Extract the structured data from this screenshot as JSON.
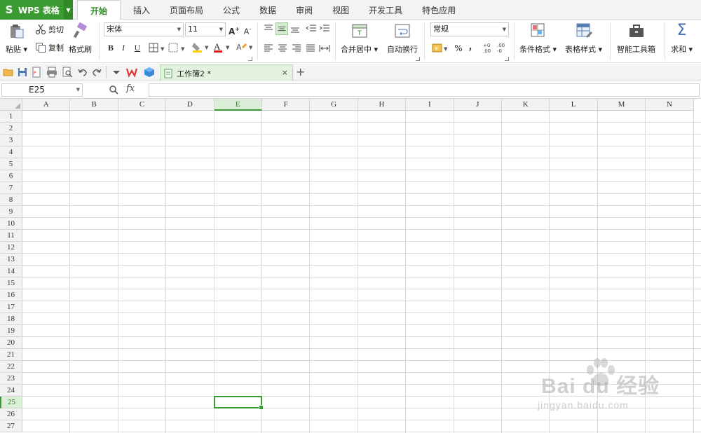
{
  "app": {
    "name": "WPS 表格",
    "logo_glyph": "S",
    "accent_color": "#3c9a32"
  },
  "menu": {
    "tabs": [
      {
        "label": "开始",
        "active": true
      },
      {
        "label": "插入",
        "active": false
      },
      {
        "label": "页面布局",
        "active": false
      },
      {
        "label": "公式",
        "active": false
      },
      {
        "label": "数据",
        "active": false
      },
      {
        "label": "审阅",
        "active": false
      },
      {
        "label": "视图",
        "active": false
      },
      {
        "label": "开发工具",
        "active": false
      },
      {
        "label": "特色应用",
        "active": false
      }
    ]
  },
  "ribbon": {
    "paste_label": "粘贴",
    "cut_label": "剪切",
    "copy_label": "复制",
    "format_painter_label": "格式刷",
    "font_name": "宋体",
    "font_size": "11",
    "bold_glyph": "B",
    "italic_glyph": "I",
    "underline_glyph": "U",
    "merge_center_label": "合并居中",
    "wrap_text_label": "自动换行",
    "number_format": "常规",
    "percent_glyph": "%",
    "comma_glyph": "，",
    "conditional_format_label": "条件格式",
    "table_style_label": "表格样式",
    "smart_toolbox_label": "智能工具箱",
    "sum_label": "求和",
    "sum_glyph": "Σ",
    "font_grow_glyph": "A",
    "font_shrink_glyph": "A"
  },
  "document": {
    "tab_title": "工作簿2 *",
    "close_glyph": "×",
    "new_tab_glyph": "+"
  },
  "formula_bar": {
    "cell_ref": "E25",
    "fx_label": "fx",
    "formula": ""
  },
  "sheet": {
    "columns": [
      "A",
      "B",
      "C",
      "D",
      "E",
      "F",
      "G",
      "H",
      "I",
      "J",
      "K",
      "L",
      "M",
      "N"
    ],
    "rows": [
      "1",
      "2",
      "3",
      "4",
      "5",
      "6",
      "7",
      "8",
      "9",
      "10",
      "11",
      "12",
      "13",
      "14",
      "15",
      "16",
      "17",
      "18",
      "19",
      "20",
      "21",
      "22",
      "23",
      "24",
      "25",
      "26",
      "27"
    ],
    "selected_column": "E",
    "selected_row": "25"
  },
  "watermark": {
    "line1": "Bai du 经验",
    "line2": "jingyan.baidu.com"
  }
}
